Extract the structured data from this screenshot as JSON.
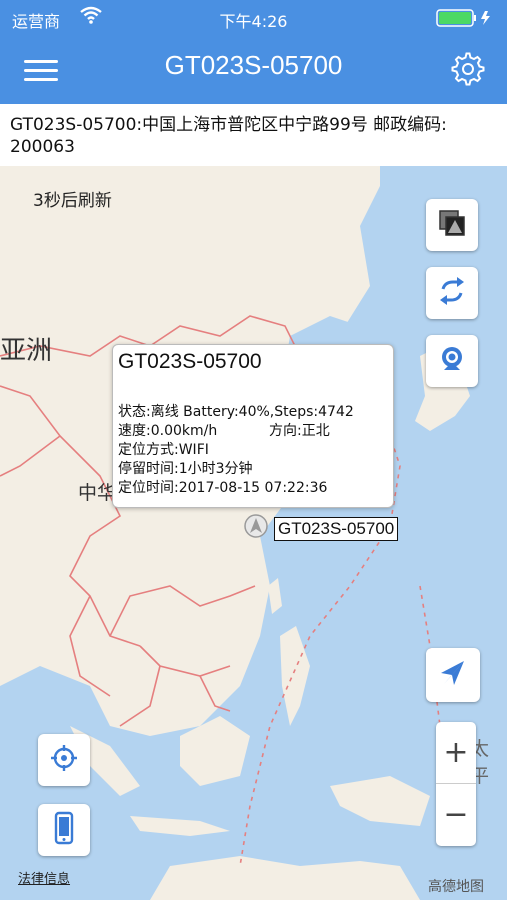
{
  "status_bar": {
    "carrier": "运营商",
    "time": "下午4:26"
  },
  "nav": {
    "title": "GT023S-05700"
  },
  "address": {
    "text": "GT023S-05700:中国上海市普陀区中宁路99号 邮政编码: 200063"
  },
  "map": {
    "refresh_text": "3秒后刷新",
    "labels": {
      "asia": "亚洲",
      "china": "中华人民共和国",
      "pacific": "太平"
    },
    "legal_link": "法律信息",
    "attribution": "高德地图",
    "zoom_in": "+",
    "zoom_out": "−"
  },
  "popup": {
    "title": "GT023S-05700",
    "status_line": "状态:离线 Battery:40%,Steps:4742",
    "speed_line": "速度:0.00km/h",
    "direction_line": "方向:正北",
    "locate_method": "定位方式:WIFI",
    "stay_time": "停留时间:1小时3分钟",
    "locate_time": "定位时间:2017-08-15 07:22:36"
  },
  "marker": {
    "label": "GT023S-05700"
  },
  "colors": {
    "nav_blue": "#4a90e2",
    "sea": "#b3d3f0",
    "land": "#f3eee4",
    "border": "#e57f7f"
  }
}
